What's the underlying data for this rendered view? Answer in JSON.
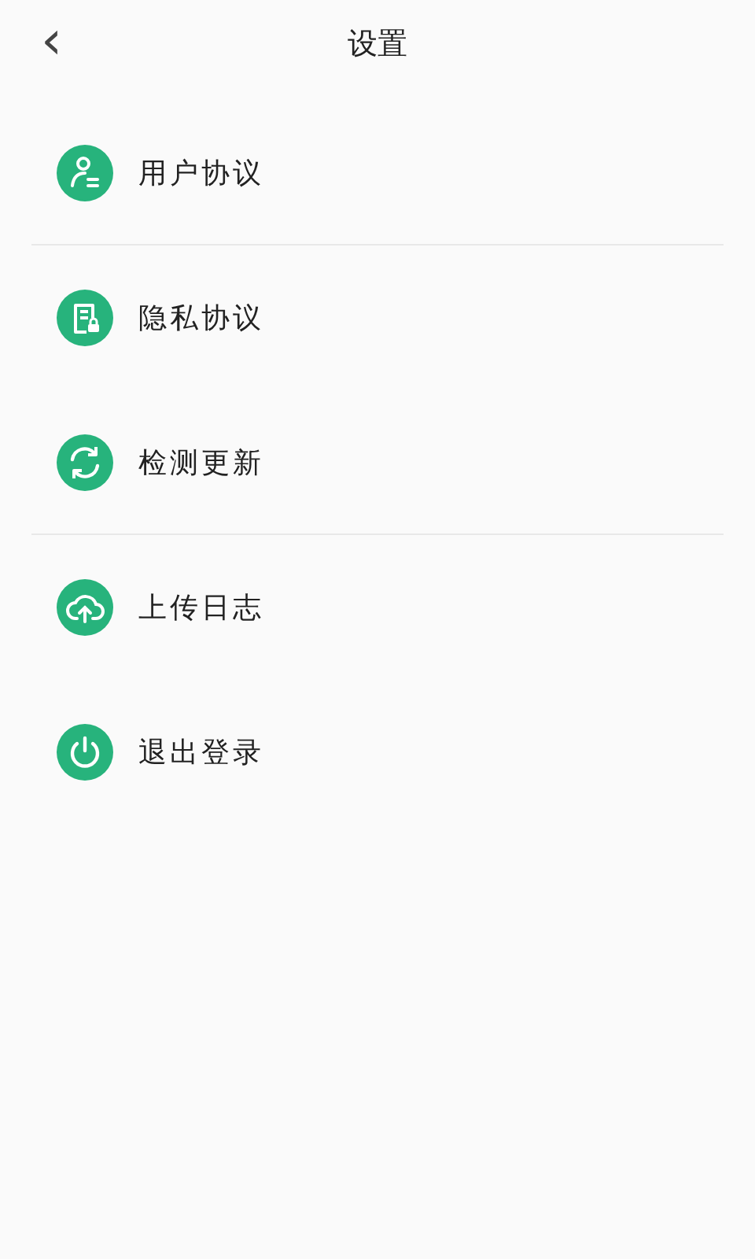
{
  "header": {
    "back": "‹",
    "title": "设置"
  },
  "items": [
    {
      "kind": "user",
      "label": "用户协议"
    },
    {
      "kind": "privacy",
      "label": "隐私协议"
    },
    {
      "kind": "update",
      "label": "检测更新"
    },
    {
      "kind": "upload",
      "label": "上传日志"
    },
    {
      "kind": "logout",
      "label": "退出登录"
    }
  ]
}
